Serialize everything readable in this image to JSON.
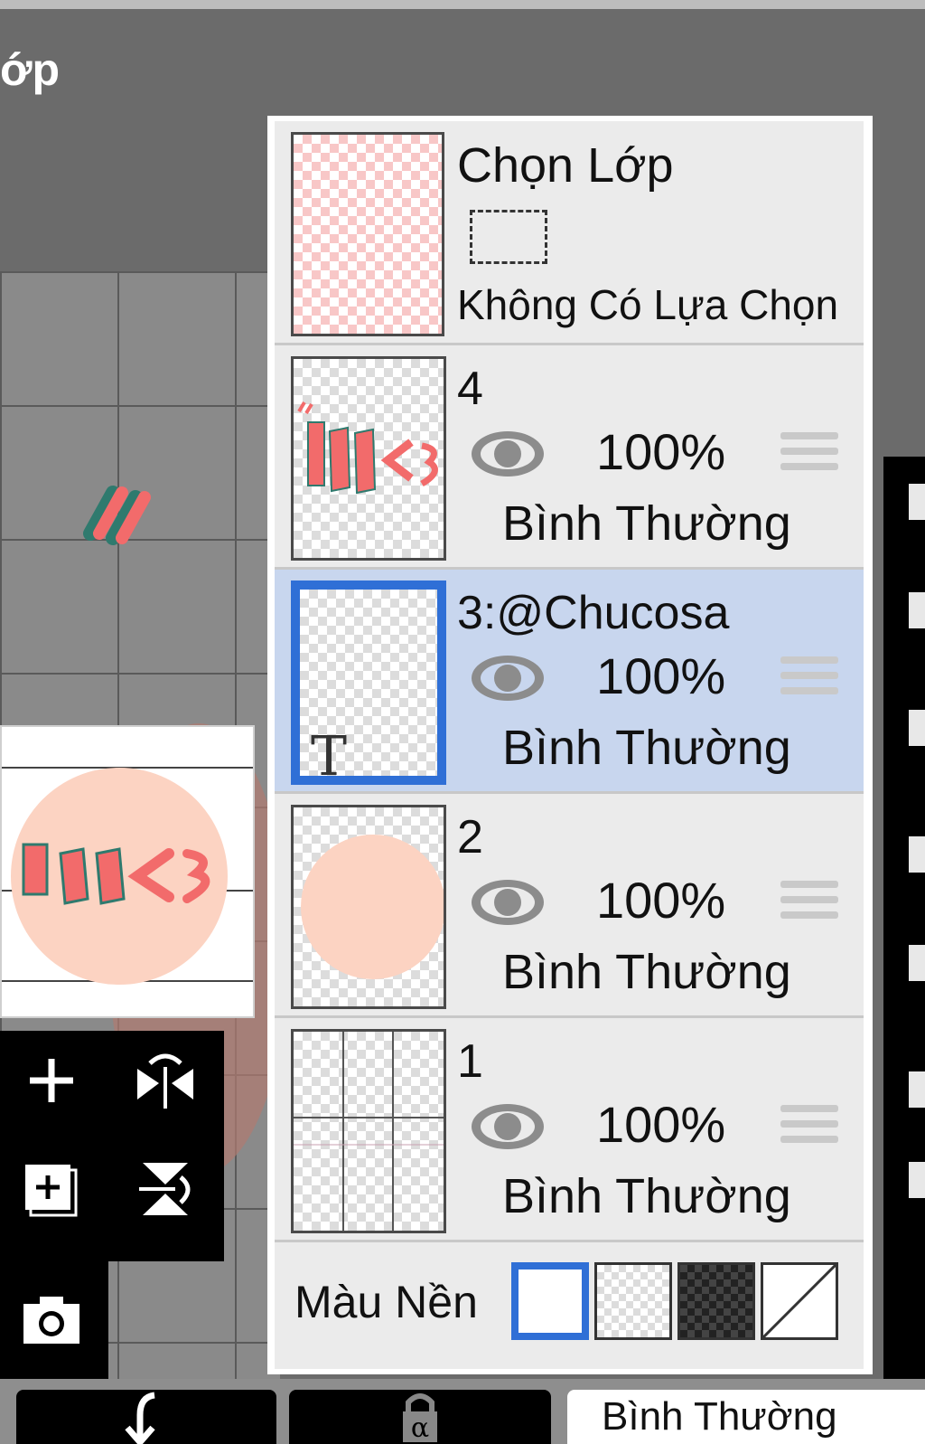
{
  "header": {
    "title": "ớp"
  },
  "layer_panel": {
    "selection_layer": {
      "title": "Chọn Lớp",
      "status": "Không Có Lựa Chọn"
    },
    "layers": [
      {
        "name": "4",
        "opacity": "100%",
        "blend": "Bình Thường",
        "visible": true,
        "selected": false
      },
      {
        "name": "3:@Chucosa",
        "opacity": "100%",
        "blend": "Bình Thường",
        "visible": true,
        "selected": true,
        "type_badge": "T"
      },
      {
        "name": "2",
        "opacity": "100%",
        "blend": "Bình Thường",
        "visible": true,
        "selected": false
      },
      {
        "name": "1",
        "opacity": "100%",
        "blend": "Bình Thường",
        "visible": true,
        "selected": false
      }
    ],
    "background": {
      "label": "Màu Nền",
      "options": [
        "white",
        "transparent-light",
        "transparent-dark",
        "none"
      ],
      "selected": "white"
    }
  },
  "left_tools": [
    "add-layer",
    "flip-horizontal",
    "add-copy-layer",
    "flip-vertical",
    "camera"
  ],
  "bottom_bar": {
    "blend_mode": "Bình Thường",
    "buttons": [
      "merge-down",
      "alpha-lock"
    ]
  },
  "colors": {
    "selected_highlight": "#c8d6ee",
    "accent_blue": "#2f6fd6",
    "art_pink": "#f26b6b",
    "art_teal": "#2f7a6e",
    "circle_peach": "#fcd3c2"
  }
}
